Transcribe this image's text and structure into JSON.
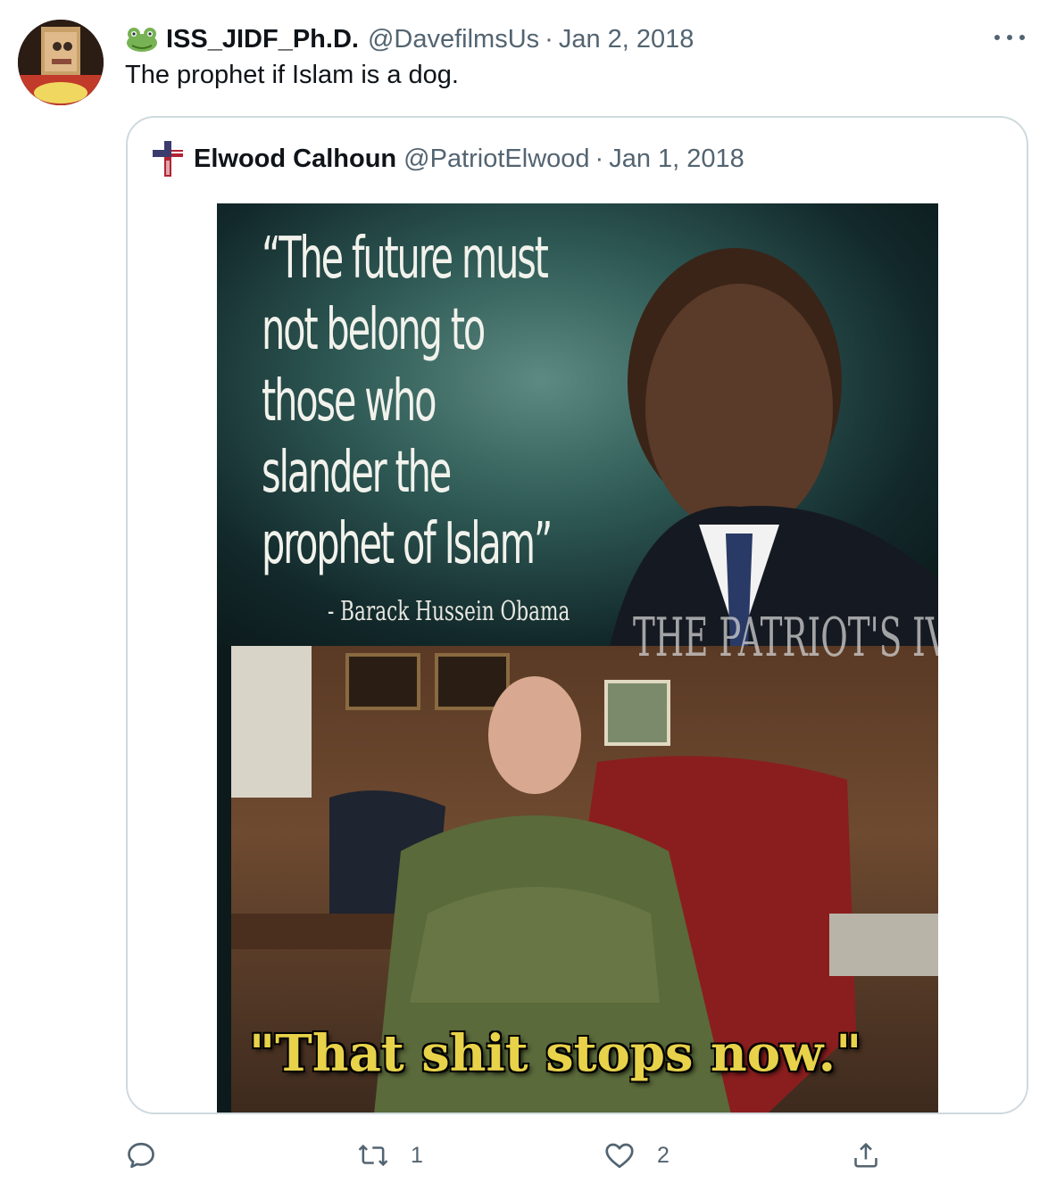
{
  "tweet": {
    "display_name": "ISS_JIDF_Ph.D.",
    "handle": "@DavefilmsUs",
    "separator": "·",
    "date": "Jan 2, 2018",
    "text": "The prophet if Islam is a dog."
  },
  "quoted_tweet": {
    "display_name": "Elwood Calhoun",
    "handle": "@PatriotElwood",
    "separator": "·",
    "date": "Jan 1, 2018",
    "image": {
      "quote_text": "“The future must\nnot belong to\nthose who\nslander the\nprophet of Islam”",
      "attribution": "- Barack Hussein Obama",
      "watermark": "THE PATRIOT'S IV DRIP",
      "caption": "\"That shit stops now.\""
    }
  },
  "actions": {
    "reply_count": "",
    "retweet_count": "1",
    "like_count": "2"
  },
  "icons": {
    "more": "more-icon",
    "reply": "reply-icon",
    "retweet": "retweet-icon",
    "like": "heart-icon",
    "share": "share-icon"
  },
  "colors": {
    "text_primary": "#0f1419",
    "text_secondary": "#536471",
    "border": "#cfd9de",
    "caption_yellow": "#e8d24a"
  }
}
